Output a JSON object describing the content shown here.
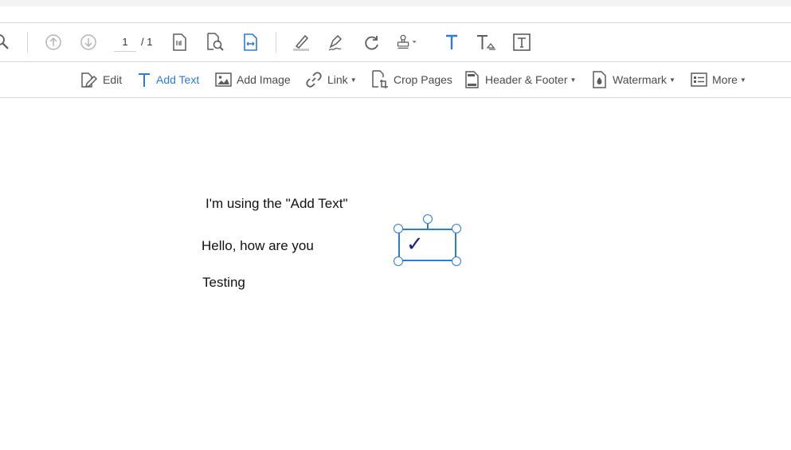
{
  "toolbar": {
    "page_current": "1",
    "page_total": "/ 1",
    "icons": [
      "zoom-out-icon",
      "page-up-icon",
      "page-down-icon",
      "actual-size-icon",
      "search-page-icon",
      "fit-width-icon",
      "highlight-icon",
      "sign-icon",
      "rotate-icon",
      "stamp-icon",
      "text-tool-icon",
      "text-annotation-icon",
      "text-box-icon"
    ]
  },
  "edit_bar": {
    "edit": "Edit",
    "add_text": "Add Text",
    "add_image": "Add Image",
    "link": "Link",
    "crop_pages": "Crop Pages",
    "header_footer": "Header & Footer",
    "watermark": "Watermark",
    "more": "More",
    "caret": "▼"
  },
  "document": {
    "line1": "I'm using the \"Add Text\"",
    "line2": "Hello, how are you",
    "line3": "Testing",
    "checkbox_mark": "✓"
  },
  "colors": {
    "accent": "#2d7bd3",
    "check": "#1a237e",
    "icon_gray": "#5c5c5c",
    "disabled_gray": "#b5b5b5"
  }
}
